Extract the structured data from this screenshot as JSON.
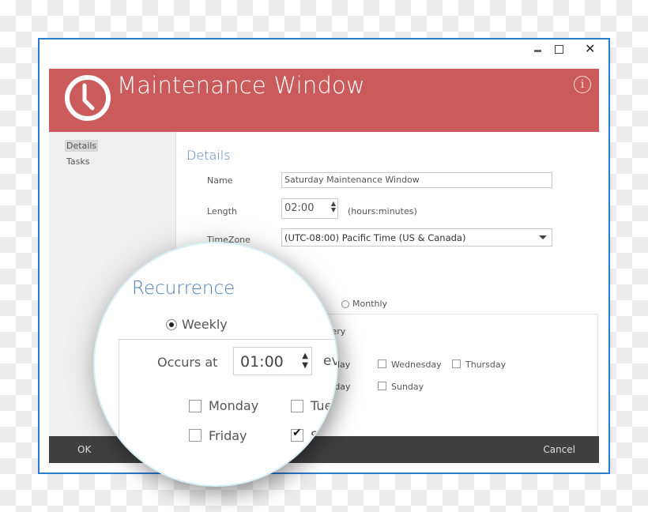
{
  "window": {
    "title": "Maintenance Window",
    "controls": {
      "minimize": "minimize",
      "maximize": "maximize",
      "close": "✕"
    },
    "info_glyph": "i"
  },
  "colors": {
    "header": "#cb5b5b",
    "accent": "#4e7fb8",
    "footer": "#404040",
    "window_border": "#2b7cd3"
  },
  "sidebar": {
    "items": [
      {
        "label": "Details",
        "active": true
      },
      {
        "label": "Tasks",
        "active": false
      }
    ]
  },
  "details": {
    "section_title": "Details",
    "name_label": "Name",
    "name_value": "Saturday Maintenance Window",
    "length_label": "Length",
    "length_value": "02:00",
    "length_hint": "(hours:minutes)",
    "timezone_label": "TimeZone",
    "timezone_value": "(UTC-08:00) Pacific Time (US & Canada)"
  },
  "recurrence": {
    "section_title": "Recurrence",
    "options": [
      {
        "label": "Weekly",
        "selected": true
      },
      {
        "label": "Monthly",
        "selected": false
      }
    ],
    "every_partial": "very",
    "occurs_at_label": "Occurs at",
    "occurs_at_value": "01:00",
    "ev_partial": "ev",
    "day_partial_1": "day",
    "day_partial_2": "rday",
    "days": [
      {
        "label": "Monday",
        "checked": false
      },
      {
        "label": "Tue",
        "checked": false
      },
      {
        "label": "Wednesday",
        "checked": false
      },
      {
        "label": "Thursday",
        "checked": false
      },
      {
        "label": "Friday",
        "checked": false
      },
      {
        "label": "S",
        "checked": true
      },
      {
        "label": "Sunday",
        "checked": false
      }
    ]
  },
  "footer": {
    "ok_label": "OK",
    "cancel_label": "Cancel"
  },
  "spinner": {
    "up": "▲",
    "down": "▼"
  },
  "check_glyph": "✔"
}
